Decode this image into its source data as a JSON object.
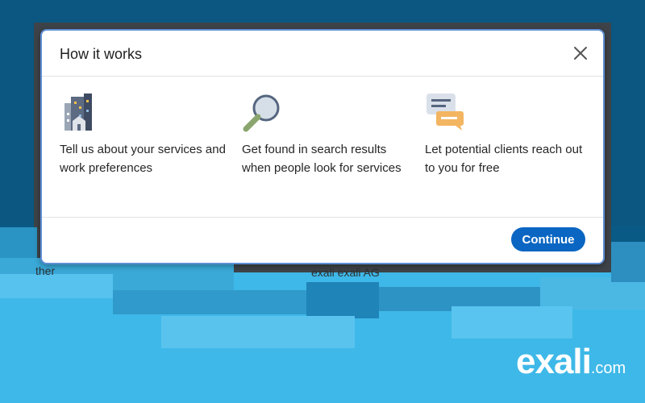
{
  "background": {
    "ghost_text_left": "ther",
    "ghost_text_center": "exali exali AG"
  },
  "dialog": {
    "title": "How it works",
    "close_label": "×",
    "steps": [
      {
        "icon": "building-icon",
        "text": "Tell us about your services and work preferences"
      },
      {
        "icon": "magnifier-icon",
        "text": "Get found in search results when people look for services"
      },
      {
        "icon": "chat-bubbles-icon",
        "text": "Let potential clients reach out to you for free"
      }
    ],
    "continue_label": "Continue"
  },
  "watermark": {
    "brand": "exali",
    "domain": ".com"
  },
  "colors": {
    "primary_button": "#0a66c2",
    "dialog_border": "#5e8fd6",
    "background_blue": "#0b5782",
    "bottom_cyan": "#3eb8e8"
  }
}
